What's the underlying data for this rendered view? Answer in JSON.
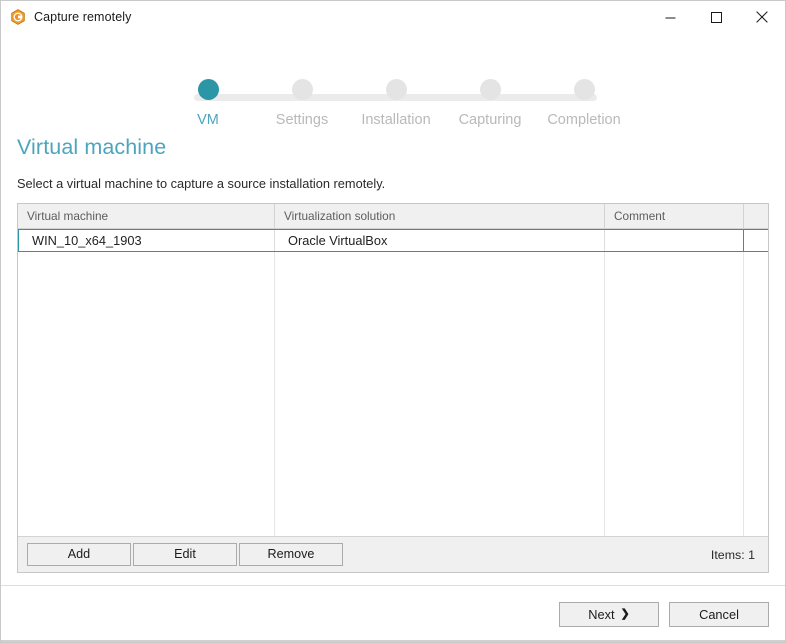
{
  "window": {
    "title": "Capture remotely",
    "app_icon": "capture-hexagon-icon",
    "accent_color": "#2b96a5",
    "heading_color": "#4da4bd",
    "controls": {
      "minimize": "minimize-icon",
      "maximize": "maximize-icon",
      "close": "close-icon"
    }
  },
  "stepper": {
    "steps": [
      {
        "label": "VM",
        "active": true
      },
      {
        "label": "Settings",
        "active": false
      },
      {
        "label": "Installation",
        "active": false
      },
      {
        "label": "Capturing",
        "active": false
      },
      {
        "label": "Completion",
        "active": false
      }
    ]
  },
  "page": {
    "title": "Virtual machine",
    "description": "Select a virtual machine to capture a source installation remotely."
  },
  "grid": {
    "columns": [
      "Virtual machine",
      "Virtualization solution",
      "Comment",
      ""
    ],
    "rows": [
      {
        "virtual_machine": "WIN_10_x64_1903",
        "virtualization_solution": "Oracle VirtualBox",
        "comment": "",
        "extra": "",
        "selected": true
      }
    ],
    "toolbar": {
      "add_label": "Add",
      "edit_label": "Edit",
      "remove_label": "Remove",
      "items_count": "Items: 1"
    }
  },
  "footer": {
    "next_label": "Next",
    "next_chevron": "chevron-right-icon",
    "cancel_label": "Cancel"
  }
}
